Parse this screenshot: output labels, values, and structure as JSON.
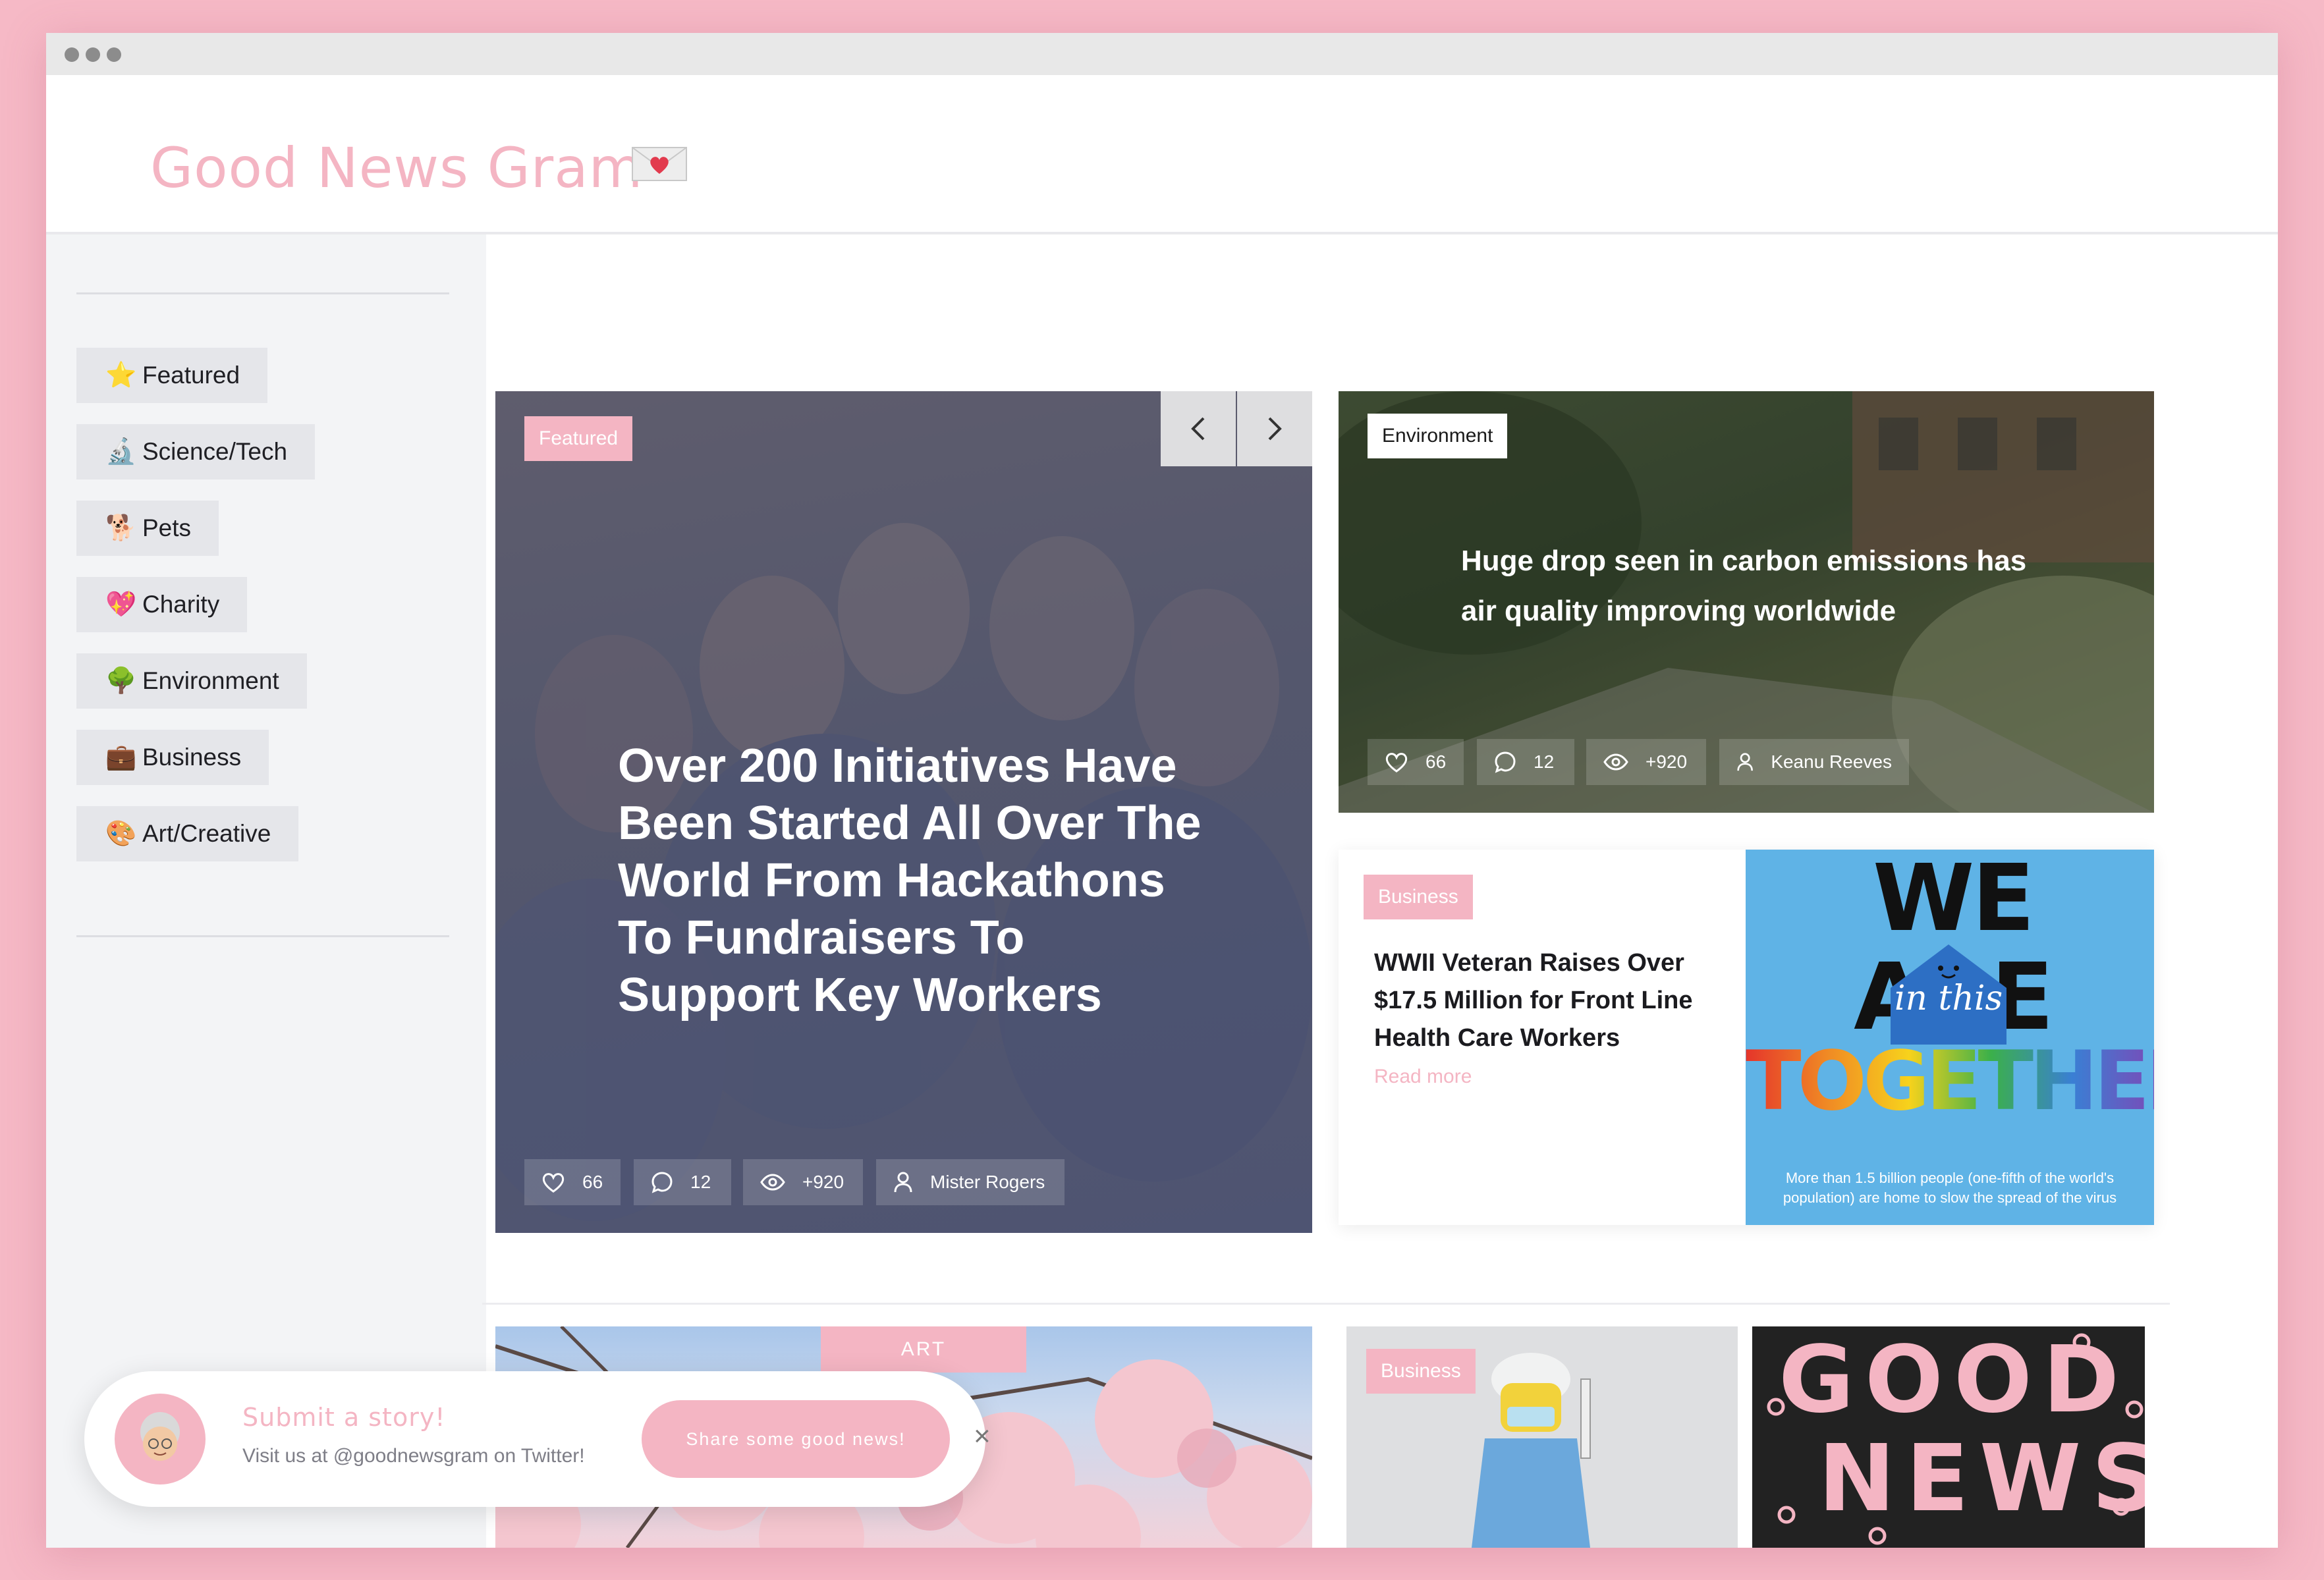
{
  "app": {
    "title": "Good News Gram",
    "accent": "#f4b5c3"
  },
  "sidebar": {
    "items": [
      {
        "icon": "star-icon",
        "emoji": "⭐",
        "label": "Featured"
      },
      {
        "icon": "microscope-icon",
        "emoji": "🔬",
        "label": "Science/Tech"
      },
      {
        "icon": "dog-icon",
        "emoji": "🐕",
        "label": "Pets"
      },
      {
        "icon": "sparkling-heart-icon",
        "emoji": "💖",
        "label": "Charity"
      },
      {
        "icon": "tree-icon",
        "emoji": "🌳",
        "label": "Environment"
      },
      {
        "icon": "briefcase-icon",
        "emoji": "💼",
        "label": "Business"
      },
      {
        "icon": "palette-icon",
        "emoji": "🎨",
        "label": "Art/Creative"
      }
    ]
  },
  "featured": {
    "tag": "Featured",
    "headline": "Over 200 Initiatives Have Been Started All Over The World From Hackathons To Fundraisers To Support Key Workers",
    "stats": {
      "likes": "66",
      "comments": "12",
      "views": "+920",
      "author": "Mister Rogers"
    }
  },
  "environment": {
    "tag": "Environment",
    "headline": "Huge drop seen in carbon emissions has air quality improving worldwide",
    "stats": {
      "likes": "66",
      "comments": "12",
      "views": "+920",
      "author": "Keanu Reeves"
    }
  },
  "business": {
    "tag": "Business",
    "headline": "WWII Veteran Raises Over $17.5 Million for Front Line Health Care Workers",
    "read_more": "Read more",
    "poster": {
      "line1": "WE ARE",
      "line2": "in this",
      "line3": "TOGETHER",
      "caption": "More than 1.5 billion people (one-fifth of the world's population) are home to slow the spread of the virus"
    }
  },
  "row2": {
    "art_tag": "ART",
    "business_tag": "Business",
    "good_news_line1": "GOOD",
    "good_news_line2": "NEWS"
  },
  "toast": {
    "title": "Submit a story!",
    "subtitle": "Visit us at @goodnewsgram on Twitter!",
    "button": "Share some good news!",
    "close": "×"
  }
}
